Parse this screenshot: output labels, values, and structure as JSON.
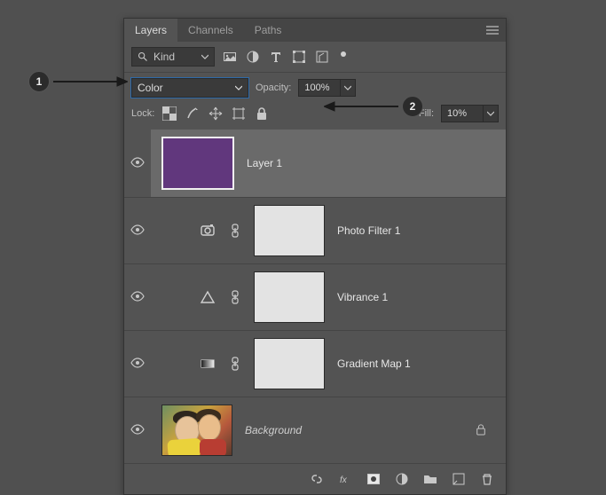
{
  "tabs": {
    "layers": "Layers",
    "channels": "Channels",
    "paths": "Paths"
  },
  "filter": {
    "kind_label": "Kind"
  },
  "blend": {
    "mode": "Color",
    "opacity_label": "Opacity:",
    "opacity_value": "100%"
  },
  "lock": {
    "label": "Lock:",
    "fill_label": "Fill:",
    "fill_value": "10%"
  },
  "layers": {
    "layer1": "Layer 1",
    "photoFilter": "Photo Filter 1",
    "vibrance": "Vibrance 1",
    "gradMap": "Gradient Map 1",
    "background": "Background"
  },
  "callouts": {
    "one": "1",
    "two": "2"
  }
}
